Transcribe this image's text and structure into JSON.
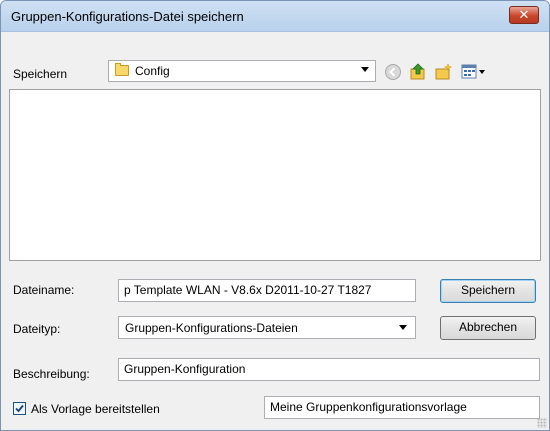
{
  "window": {
    "title": "Gruppen-Konfigurations-Datei speichern",
    "close_glyph": "✕"
  },
  "save_in": {
    "label": "Speichern",
    "folder": "Config",
    "folder_icon": "folder-icon"
  },
  "toolbar": {
    "icons": [
      "back-icon",
      "up-folder-icon",
      "new-folder-icon",
      "view-menu-icon"
    ]
  },
  "file_list": {
    "items": []
  },
  "filename": {
    "label": "Dateiname:",
    "value": "p Template WLAN - V8.6x D2011-10-27 T1827"
  },
  "filetype": {
    "label": "Dateityp:",
    "value": "Gruppen-Konfigurations-Dateien"
  },
  "description": {
    "label": "Beschreibung:",
    "value": "Gruppen-Konfiguration"
  },
  "template": {
    "checkbox_label": "Als Vorlage bereitstellen",
    "checked": true,
    "name_value": "Meine Gruppenkonfigurationsvorlage"
  },
  "buttons": {
    "save": "Speichern",
    "cancel": "Abbrechen"
  }
}
